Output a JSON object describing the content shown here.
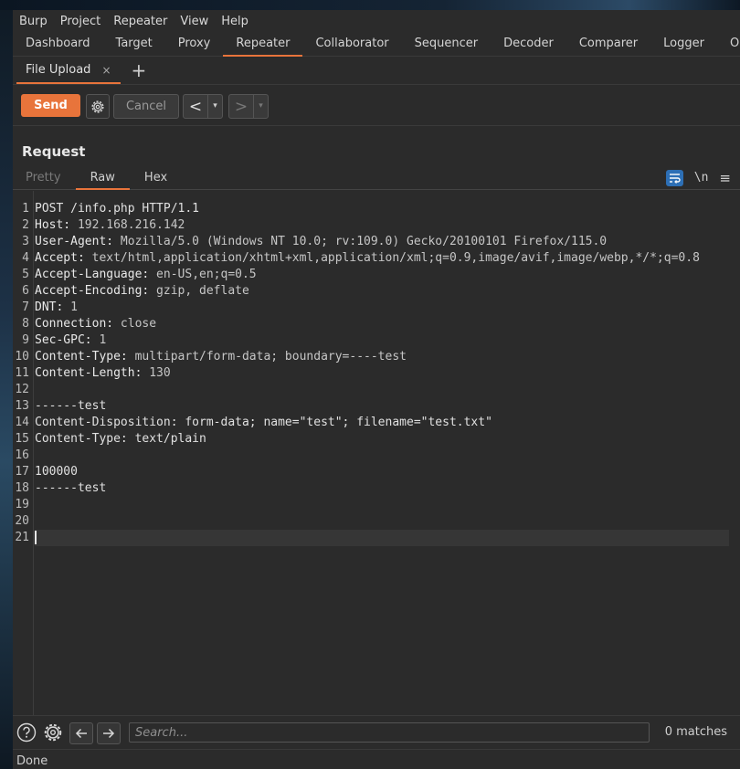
{
  "menu": [
    "Burp",
    "Project",
    "Repeater",
    "View",
    "Help"
  ],
  "main_tabs": [
    "Dashboard",
    "Target",
    "Proxy",
    "Repeater",
    "Collaborator",
    "Sequencer",
    "Decoder",
    "Comparer",
    "Logger",
    "O"
  ],
  "active_main_tab": "Repeater",
  "sub_tab": {
    "label": "File Upload",
    "close": "×",
    "add": "+"
  },
  "toolbar": {
    "send": "Send",
    "cancel": "Cancel",
    "back": "<",
    "forward": ">",
    "dropdown": "▾"
  },
  "request": {
    "title": "Request",
    "view_tabs": [
      "Pretty",
      "Raw",
      "Hex"
    ],
    "active_view": "Raw",
    "newline_toggle": "\\n",
    "options_icon": "≡",
    "lines": [
      {
        "n": "1",
        "name": "POST /info.php HTTP/1.1",
        "value": ""
      },
      {
        "n": "2",
        "name": "Host:",
        "value": " 192.168.216.142"
      },
      {
        "n": "3",
        "name": "User-Agent:",
        "value": " Mozilla/5.0 (Windows NT 10.0; rv:109.0) Gecko/20100101 Firefox/115.0"
      },
      {
        "n": "4",
        "name": "Accept:",
        "value": " text/html,application/xhtml+xml,application/xml;q=0.9,image/avif,image/webp,*/*;q=0.8"
      },
      {
        "n": "5",
        "name": "Accept-Language:",
        "value": " en-US,en;q=0.5"
      },
      {
        "n": "6",
        "name": "Accept-Encoding:",
        "value": " gzip, deflate"
      },
      {
        "n": "7",
        "name": "DNT:",
        "value": " 1"
      },
      {
        "n": "8",
        "name": "Connection:",
        "value": " close"
      },
      {
        "n": "9",
        "name": "Sec-GPC:",
        "value": " 1"
      },
      {
        "n": "10",
        "name": "Content-Type:",
        "value": " multipart/form-data; boundary=----test"
      },
      {
        "n": "11",
        "name": "Content-Length:",
        "value": " 130"
      },
      {
        "n": "12",
        "name": "",
        "value": ""
      },
      {
        "n": "13",
        "name": "------test",
        "value": ""
      },
      {
        "n": "14",
        "name": "Content-Disposition: form-data; name=\"test\"; filename=\"test.txt\"",
        "value": ""
      },
      {
        "n": "15",
        "name": "Content-Type: text/plain",
        "value": ""
      },
      {
        "n": "16",
        "name": "",
        "value": ""
      },
      {
        "n": "17",
        "name": "100000",
        "value": ""
      },
      {
        "n": "18",
        "name": "------test",
        "value": ""
      },
      {
        "n": "19",
        "name": "",
        "value": ""
      },
      {
        "n": "20",
        "name": "",
        "value": ""
      },
      {
        "n": "21",
        "name": "",
        "value": ""
      }
    ]
  },
  "search": {
    "placeholder": "Search...",
    "matches": "0 matches"
  },
  "status": "Done",
  "colors": {
    "accent": "#e8743b",
    "wrap_toggle": "#2d6fb5"
  }
}
